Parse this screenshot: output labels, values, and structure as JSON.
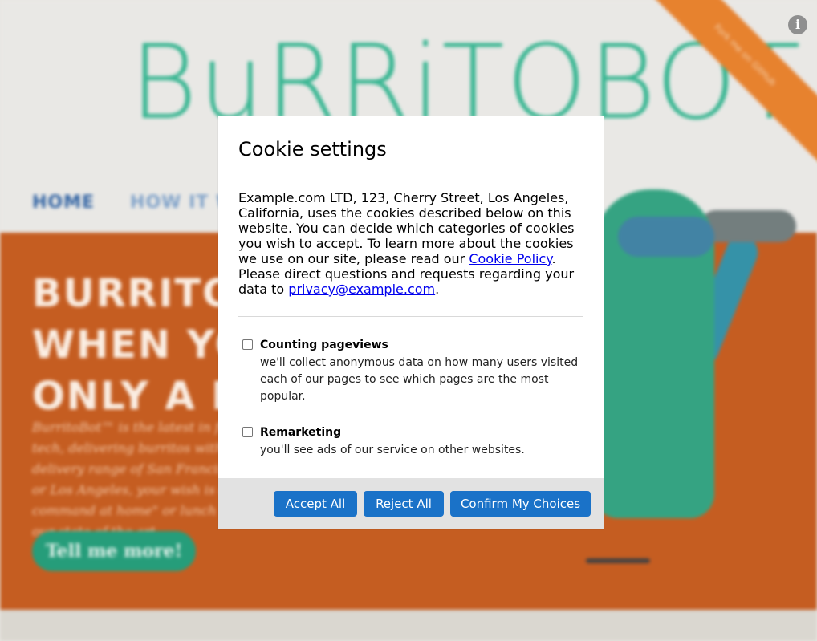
{
  "background": {
    "logo": "BuRRiTOBOT",
    "ribbon_text": "Fork me on GitHub",
    "info_icon": "info-icon",
    "nav": [
      "HOME",
      "HOW IT WORKS"
    ],
    "hero_lines": [
      "BURRITOS",
      "WHEN YOU",
      "ONLY A LA"
    ],
    "hero_copy": "BurritoBot™ is the latest in food tech, delivering burritos within delivery range of San Francisco or Los Angeles, your wish is our command at home\" or lunch using our state-of-the-art",
    "cta_label": "Tell me more!",
    "colors": {
      "hero": "#c4581a",
      "logo": "#33b48f",
      "button": "#1f9a76"
    }
  },
  "modal": {
    "title": "Cookie settings",
    "intro_before_link": "Example.com LTD, 123, Cherry Street, Los Angeles, California, uses the cookies described below on this website. You can decide which categories of cookies you wish to accept. To learn more about the cookies we use on our site, please read our ",
    "cookie_policy_link": "Cookie Policy",
    "intro_middle": ". Please direct questions and requests regarding your data to ",
    "privacy_email": "privacy@example.com",
    "intro_end": ".",
    "options": [
      {
        "title": "Counting pageviews",
        "description": "we'll collect anonymous data on how many users visited each of our pages to see which pages are the most popular.",
        "checked": false
      },
      {
        "title": "Remarketing",
        "description": "you'll see ads of our service on other websites.",
        "checked": false
      }
    ],
    "buttons": {
      "accept_all": "Accept All",
      "reject_all": "Reject All",
      "confirm": "Confirm My Choices"
    },
    "colors": {
      "button": "#1a72c8",
      "footer": "#e2e2e2",
      "link": "#0000ee"
    }
  }
}
